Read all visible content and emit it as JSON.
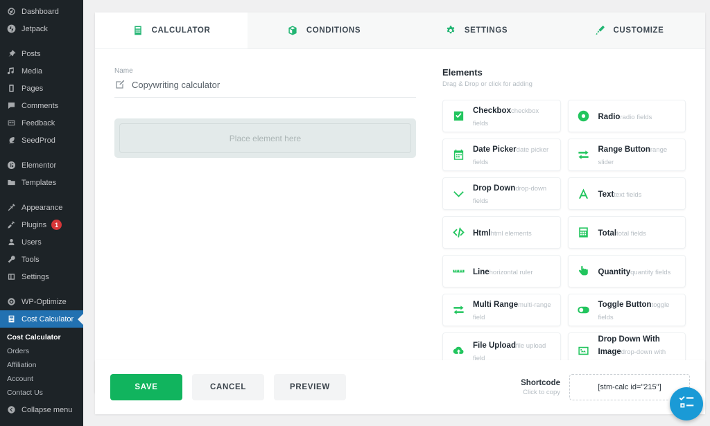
{
  "sidebar": {
    "items": [
      {
        "label": "Dashboard",
        "icon": "dashboard-icon",
        "group": 0
      },
      {
        "label": "Jetpack",
        "icon": "jetpack-icon",
        "group": 0
      },
      {
        "label": "Posts",
        "icon": "pin-icon",
        "group": 1
      },
      {
        "label": "Media",
        "icon": "media-icon",
        "group": 1
      },
      {
        "label": "Pages",
        "icon": "pages-icon",
        "group": 1
      },
      {
        "label": "Comments",
        "icon": "comments-icon",
        "group": 1
      },
      {
        "label": "Feedback",
        "icon": "feedback-icon",
        "group": 1
      },
      {
        "label": "SeedProd",
        "icon": "seedprod-icon",
        "group": 1
      },
      {
        "label": "Elementor",
        "icon": "elementor-icon",
        "group": 2
      },
      {
        "label": "Templates",
        "icon": "templates-icon",
        "group": 2
      },
      {
        "label": "Appearance",
        "icon": "appearance-icon",
        "group": 3
      },
      {
        "label": "Plugins",
        "icon": "plugins-icon",
        "group": 3,
        "badge": "1"
      },
      {
        "label": "Users",
        "icon": "users-icon",
        "group": 3
      },
      {
        "label": "Tools",
        "icon": "tools-icon",
        "group": 3
      },
      {
        "label": "Settings",
        "icon": "settings-icon",
        "group": 3
      },
      {
        "label": "WP-Optimize",
        "icon": "wp-optimize-icon",
        "group": 4
      },
      {
        "label": "Cost Calculator",
        "icon": "cost-calculator-icon",
        "group": 5,
        "active": true
      }
    ],
    "submenu": [
      {
        "label": "Cost Calculator",
        "current": true
      },
      {
        "label": "Orders"
      },
      {
        "label": "Affiliation"
      },
      {
        "label": "Account"
      },
      {
        "label": "Contact Us"
      }
    ],
    "collapse_label": "Collapse menu",
    "active_color": "#2271b1",
    "background": "#1d2327"
  },
  "tabs": [
    {
      "label": "CALCULATOR",
      "icon": "calculator-icon",
      "active": true
    },
    {
      "label": "CONDITIONS",
      "icon": "box-icon",
      "active": false
    },
    {
      "label": "SETTINGS",
      "icon": "gear-icon",
      "active": false
    },
    {
      "label": "CUSTOMIZE",
      "icon": "paintbrush-icon",
      "active": false
    }
  ],
  "form": {
    "name_label": "Name",
    "name_value": "Copywriting calculator",
    "name_icon": "edit-pencil-icon",
    "dropzone_text": "Place element here"
  },
  "elements_panel": {
    "title": "Elements",
    "subtitle": "Drag & Drop or click for adding",
    "items": [
      {
        "name": "Checkbox",
        "desc": "checkbox fields",
        "icon": "checkbox-icon"
      },
      {
        "name": "Radio",
        "desc": "radio fields",
        "icon": "radio-icon"
      },
      {
        "name": "Date Picker",
        "desc": "date picker fields",
        "icon": "calendar-icon"
      },
      {
        "name": "Range Button",
        "desc": "range slider",
        "icon": "range-arrows-icon"
      },
      {
        "name": "Drop Down",
        "desc": "drop-down fields",
        "icon": "chevron-down-icon"
      },
      {
        "name": "Text",
        "desc": "text fields",
        "icon": "text-a-icon"
      },
      {
        "name": "Html",
        "desc": "html elements",
        "icon": "code-icon"
      },
      {
        "name": "Total",
        "desc": "total fields",
        "icon": "calculator-icon"
      },
      {
        "name": "Line",
        "desc": "horizontal ruler",
        "icon": "ruler-icon"
      },
      {
        "name": "Quantity",
        "desc": "quantity fields",
        "icon": "hand-pointer-icon"
      },
      {
        "name": "Multi Range",
        "desc": "multi-range field",
        "icon": "range-arrows-icon"
      },
      {
        "name": "Toggle Button",
        "desc": "toggle fields",
        "icon": "toggle-icon"
      },
      {
        "name": "File Upload",
        "desc": "file upload field",
        "icon": "cloud-upload-icon"
      },
      {
        "name": "Drop Down With Image",
        "desc": "drop-down with image field",
        "icon": "image-icon"
      }
    ],
    "accent_color": "#22c55e"
  },
  "footer": {
    "save_label": "SAVE",
    "cancel_label": "CANCEL",
    "preview_label": "PREVIEW",
    "shortcode_title": "Shortcode",
    "shortcode_hint": "Click to copy",
    "shortcode_value": "[stm-calc id=\"215\"]",
    "save_color": "#11b45e",
    "fab_icon": "tasks-icon",
    "fab_color": "#1a9ad6"
  }
}
